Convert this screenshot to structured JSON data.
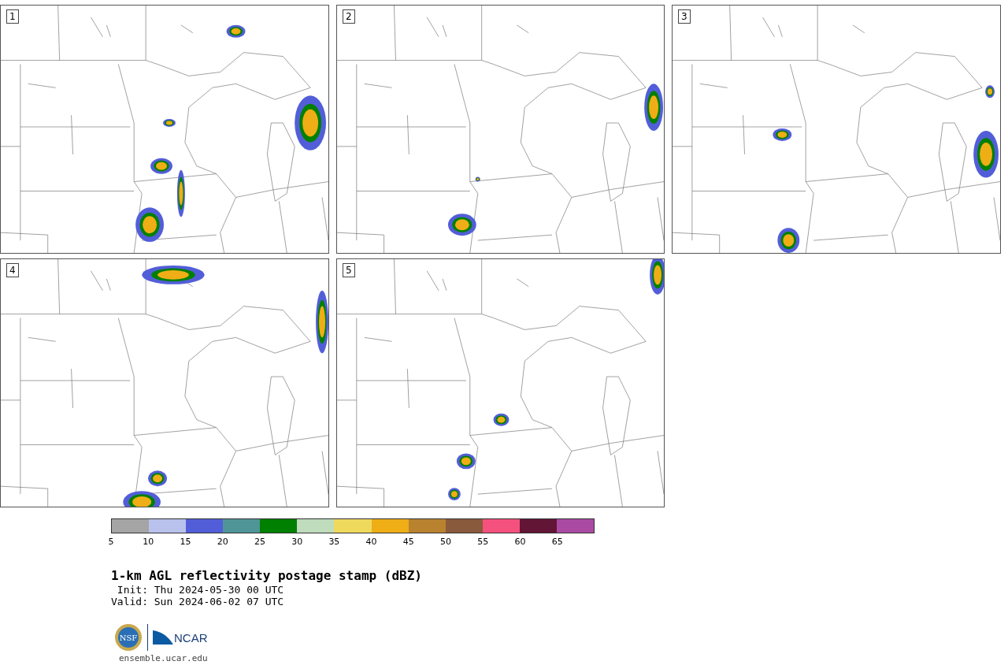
{
  "panels": [
    {
      "label": "1"
    },
    {
      "label": "2"
    },
    {
      "label": "3"
    },
    {
      "label": "4"
    },
    {
      "label": "5"
    }
  ],
  "colorbar": {
    "segments": [
      {
        "color": "#a5a5a5"
      },
      {
        "color": "#b8c2ec"
      },
      {
        "color": "#525ed8"
      },
      {
        "color": "#4f9598"
      },
      {
        "color": "#008000"
      },
      {
        "color": "#bfdcbd"
      },
      {
        "color": "#efd95c"
      },
      {
        "color": "#efad16"
      },
      {
        "color": "#b9822f"
      },
      {
        "color": "#8a5a3c"
      },
      {
        "color": "#f5517e"
      },
      {
        "color": "#631536"
      },
      {
        "color": "#ab4aa3"
      }
    ],
    "ticks": [
      "5",
      "10",
      "15",
      "20",
      "25",
      "30",
      "35",
      "40",
      "45",
      "50",
      "55",
      "60",
      "65"
    ]
  },
  "title": "1-km AGL reflectivity postage stamp (dBZ)",
  "init": " Init: Thu 2024-05-30 00 UTC",
  "valid": "Valid: Sun 2024-06-02 07 UTC",
  "logos": {
    "nsf": "NSF",
    "ncar": "NCAR"
  },
  "url": "ensemble.ucar.edu"
}
